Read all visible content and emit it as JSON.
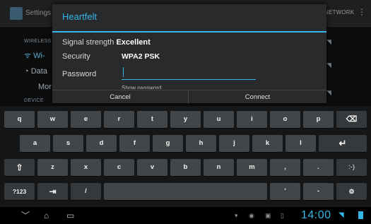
{
  "background": {
    "title": "Settings",
    "network_label": "NETWORK",
    "section_wireless": "WIRELESS",
    "wifi_item": "Wi-",
    "data_item": "Data",
    "more_item": "Mor",
    "section_device": "DEVICE"
  },
  "dialog": {
    "title": "Heartfelt",
    "signal_label": "Signal strength",
    "signal_value": "Excellent",
    "security_label": "Security",
    "security_value": "WPA2 PSK",
    "password_label": "Password",
    "password_value": "",
    "show_password_label": "Show password",
    "cancel_label": "Cancel",
    "connect_label": "Connect"
  },
  "keyboard": {
    "row1": [
      {
        "label": "q",
        "hint": ""
      },
      {
        "label": "w",
        "hint": ""
      },
      {
        "label": "e",
        "hint": ""
      },
      {
        "label": "r",
        "hint": ""
      },
      {
        "label": "t",
        "hint": ""
      },
      {
        "label": "y",
        "hint": ""
      },
      {
        "label": "u",
        "hint": ""
      },
      {
        "label": "i",
        "hint": ""
      },
      {
        "label": "o",
        "hint": ""
      },
      {
        "label": "p",
        "hint": ""
      }
    ],
    "row1_delete": "⌫",
    "row2": [
      {
        "label": "a",
        "hint": ""
      },
      {
        "label": "s",
        "hint": ""
      },
      {
        "label": "d",
        "hint": ""
      },
      {
        "label": "f",
        "hint": ""
      },
      {
        "label": "g",
        "hint": ""
      },
      {
        "label": "h",
        "hint": ""
      },
      {
        "label": "j",
        "hint": ""
      },
      {
        "label": "k",
        "hint": ""
      },
      {
        "label": "l",
        "hint": ""
      }
    ],
    "row2_enter": "↵",
    "row3_shift": "⇧",
    "row3": [
      {
        "label": "z",
        "hint": ""
      },
      {
        "label": "x",
        "hint": ""
      },
      {
        "label": "c",
        "hint": ""
      },
      {
        "label": "v",
        "hint": ""
      },
      {
        "label": "b",
        "hint": ""
      },
      {
        "label": "n",
        "hint": ""
      },
      {
        "label": "m",
        "hint": ""
      }
    ],
    "row3_comma": ",",
    "row3_period": ".",
    "row3_smiley": ":-)",
    "row4_symbols": "?123",
    "row4_tab": "⇥",
    "row4_slash": "/",
    "row4_space": "",
    "row4_apostrophe": "'",
    "row4_hyphen": "-",
    "row4_settings": "⚙"
  },
  "navbar": {
    "back_icon": "chevron-down-icon",
    "home_icon": "home-icon",
    "recents_icon": "recents-icon",
    "clock": "14:00"
  },
  "colors": {
    "accent": "#33b5e5",
    "dialog_bg": "#282a2c",
    "key_bg": "#434648",
    "keyboard_bg": "#141618"
  }
}
